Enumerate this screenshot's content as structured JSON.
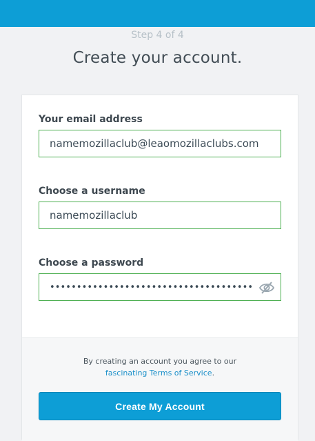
{
  "header": {
    "step": "Step 4 of 4",
    "title": "Create your account."
  },
  "form": {
    "email": {
      "label": "Your email address",
      "value": "namemozillaclub@leaomozillaclubs.com"
    },
    "username": {
      "label": "Choose a username",
      "value": "namemozillaclub"
    },
    "password": {
      "label": "Choose a password",
      "value": "••••••••••••••••••••••••••••••••••••••",
      "toggle_icon": "eye-slash-icon"
    }
  },
  "footer": {
    "terms_prefix": "By creating an account you agree to our",
    "terms_link_word": "fascinating",
    "terms_link": "Terms of Service",
    "terms_suffix": ".",
    "submit_label": "Create My Account"
  },
  "colors": {
    "brand_blue": "#0d9ed6",
    "valid_green": "#4caf50",
    "link": "#1a8fc9"
  }
}
